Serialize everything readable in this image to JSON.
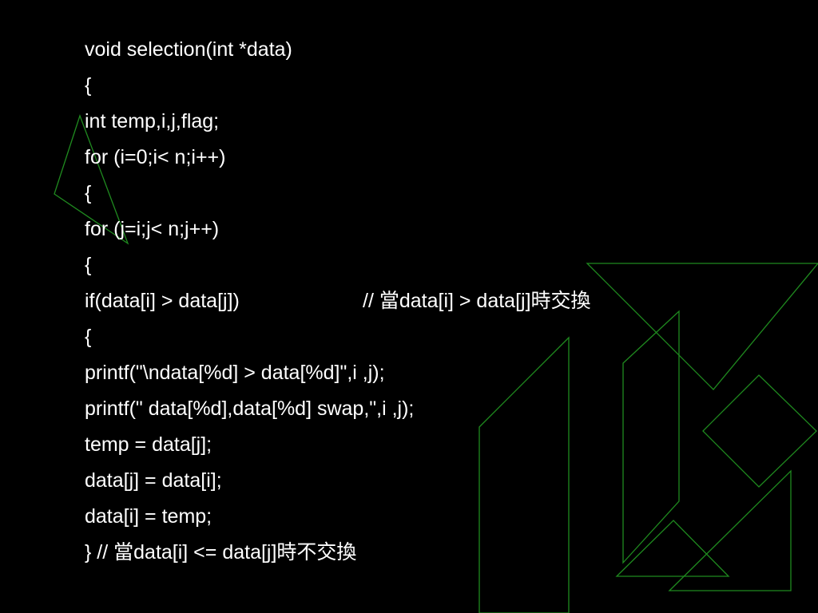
{
  "slide": {
    "code_lines": [
      "void selection(int *data)",
      "{",
      "int temp,i,j,flag;",
      "for (i=0;i< n;i++)",
      "{",
      "for (j=i;j< n;j++)",
      "{",
      "if(data[i] > data[j])",
      "{",
      "printf(\"\\ndata[%d] > data[%d]\",i ,j);",
      "printf(\" data[%d],data[%d] swap,\",i ,j);",
      "temp = data[j];",
      "data[j] = data[i];",
      "data[i] = temp;",
      "} // 當data[i] <= data[j]時不交換"
    ],
    "inline_comment": "// 當data[i] > data[j]時交換",
    "decor_color": "#1f8a1f",
    "background_color": "#000000",
    "text_color": "#ffffff"
  }
}
